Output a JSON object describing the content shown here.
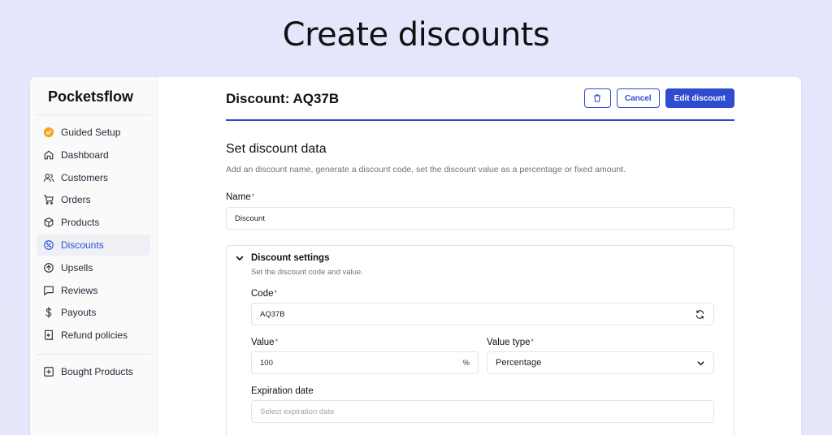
{
  "hero": {
    "title": "Create discounts"
  },
  "sidebar": {
    "brand": "Pocketsflow",
    "items": [
      {
        "label": "Guided Setup",
        "icon": "badge-check-icon"
      },
      {
        "label": "Dashboard",
        "icon": "home-icon"
      },
      {
        "label": "Customers",
        "icon": "users-icon"
      },
      {
        "label": "Orders",
        "icon": "cart-icon"
      },
      {
        "label": "Products",
        "icon": "box-icon"
      },
      {
        "label": "Discounts",
        "icon": "discount-icon",
        "active": true
      },
      {
        "label": "Upsells",
        "icon": "arrow-up-circle-icon"
      },
      {
        "label": "Reviews",
        "icon": "message-icon"
      },
      {
        "label": "Payouts",
        "icon": "dollar-icon"
      },
      {
        "label": "Refund policies",
        "icon": "receipt-refund-icon"
      }
    ],
    "bottom_items": [
      {
        "label": "Bought Products",
        "icon": "folder-plus-icon"
      }
    ]
  },
  "header": {
    "title": "Discount: AQ37B",
    "cancel_label": "Cancel",
    "edit_label": "Edit discount"
  },
  "section": {
    "title": "Set discount data",
    "description": "Add an discount name, generate a discount code, set the discount value as a percentage or fixed amount."
  },
  "form": {
    "name_label": "Name",
    "name_value": "Discount",
    "required_mark": "*",
    "settings": {
      "title": "Discount settings",
      "description": "Set the discount code and value.",
      "code_label": "Code",
      "code_value": "AQ37B",
      "value_label": "Value",
      "value_value": "100",
      "value_suffix": "%",
      "type_label": "Value type",
      "type_value": "Percentage",
      "expiration_label": "Expiration date",
      "expiration_placeholder": "Select expiration date"
    }
  },
  "colors": {
    "accent": "#2f4bd0",
    "active_text": "#2b4fd8",
    "active_bg": "#eef0f6",
    "guided_badge": "#f5a524",
    "required": "#dc2626"
  }
}
